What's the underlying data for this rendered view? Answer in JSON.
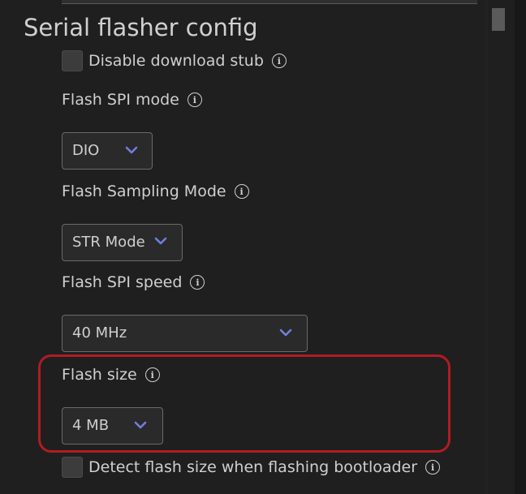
{
  "section": {
    "title": "Serial flasher config"
  },
  "settings": {
    "disable_download_stub": {
      "label": "Disable download stub",
      "checked": false
    },
    "flash_spi_mode": {
      "label": "Flash SPI mode",
      "value": "DIO"
    },
    "flash_sampling_mode": {
      "label": "Flash Sampling Mode",
      "value": "STR Mode"
    },
    "flash_spi_speed": {
      "label": "Flash SPI speed",
      "value": "40 MHz"
    },
    "flash_size": {
      "label": "Flash size",
      "value": "4 MB"
    },
    "detect_flash_size": {
      "label": "Detect flash size when flashing bootloader",
      "checked": false
    }
  },
  "colors": {
    "background": "#1f1f1f",
    "chevron": "#6f7fe0",
    "highlight": "#b01c22"
  },
  "icons": {
    "info": "info-circle-icon",
    "chevron": "chevron-down-icon"
  }
}
